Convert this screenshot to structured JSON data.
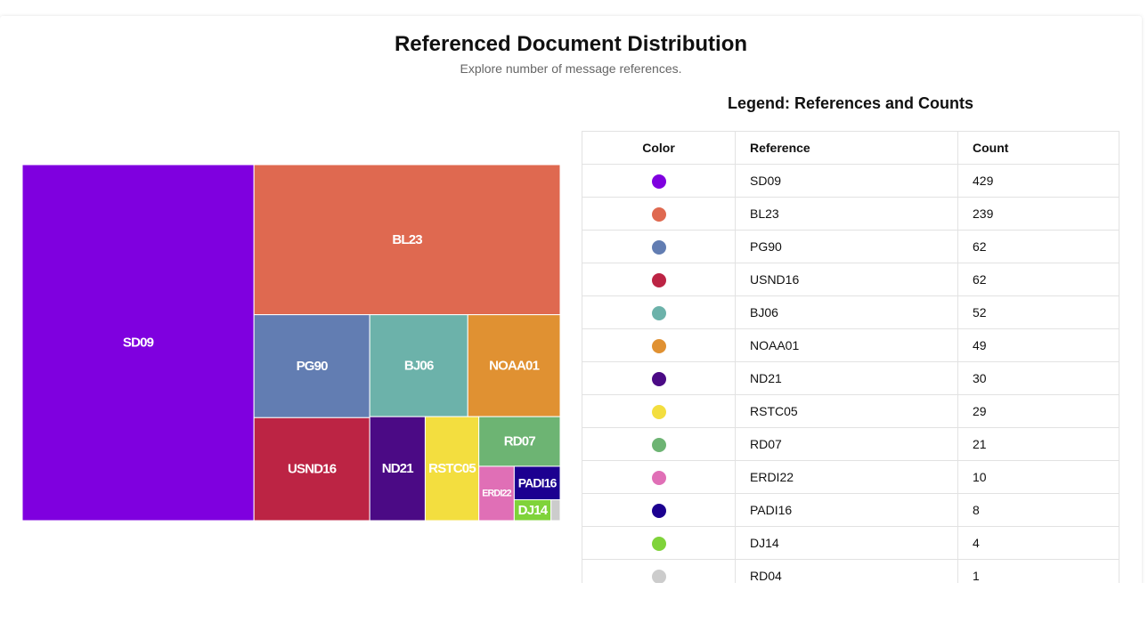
{
  "header": {
    "title": "Referenced Document Distribution",
    "subtitle": "Explore number of message references."
  },
  "legend": {
    "title": "Legend: References and Counts",
    "columns": [
      "Color",
      "Reference",
      "Count"
    ]
  },
  "chart_data": {
    "type": "treemap",
    "title": "Referenced Document Distribution",
    "subtitle": "Explore number of message references.",
    "items": [
      {
        "name": "SD09",
        "value": 429,
        "color": "#7f00df"
      },
      {
        "name": "BL23",
        "value": 239,
        "color": "#df6950"
      },
      {
        "name": "PG90",
        "value": 62,
        "color": "#627db2"
      },
      {
        "name": "USND16",
        "value": 62,
        "color": "#bc2444"
      },
      {
        "name": "BJ06",
        "value": 52,
        "color": "#6cb2aa"
      },
      {
        "name": "NOAA01",
        "value": 49,
        "color": "#e09132"
      },
      {
        "name": "ND21",
        "value": 30,
        "color": "#4b0a85"
      },
      {
        "name": "RSTC05",
        "value": 29,
        "color": "#f3de3f"
      },
      {
        "name": "RD07",
        "value": 21,
        "color": "#6db473"
      },
      {
        "name": "ERDI22",
        "value": 10,
        "color": "#e06fb6"
      },
      {
        "name": "PADI16",
        "value": 8,
        "color": "#1c0090"
      },
      {
        "name": "DJ14",
        "value": 4,
        "color": "#7fd33a"
      },
      {
        "name": "RD04",
        "value": 1,
        "color": "#cccccc"
      }
    ]
  }
}
